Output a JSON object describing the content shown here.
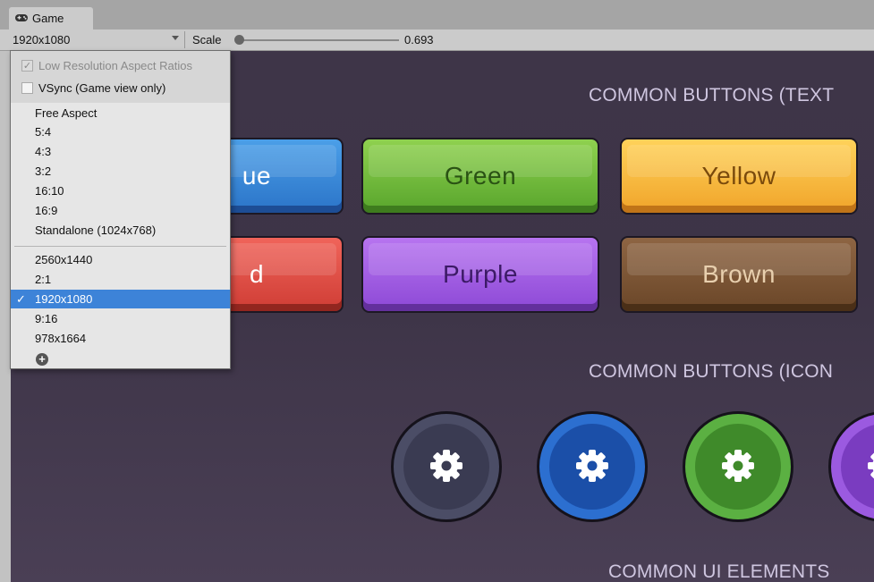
{
  "window": {
    "tab_label": "Game",
    "tab_icon": "gamepad-icon"
  },
  "toolbar": {
    "resolution": "1920x1080",
    "scale_label": "Scale",
    "scale_value": "0.693",
    "scale_level": 0.0
  },
  "dropdown": {
    "low_res_label": "Low Resolution Aspect Ratios",
    "low_res_checked": true,
    "vsync_label": "VSync (Game view only)",
    "vsync_checked": false,
    "items": [
      "Free Aspect",
      "5:4",
      "4:3",
      "3:2",
      "16:10",
      "16:9",
      "Standalone (1024x768)",
      "2560x1440",
      "2:1",
      "1920x1080",
      "9:16",
      "978x1664"
    ],
    "selected": "1920x1080",
    "add_icon": "plus-circle-icon"
  },
  "game": {
    "heading_text_buttons": "COMMON BUTTONS (TEXT",
    "heading_icon_buttons": "COMMON BUTTONS (ICON",
    "heading_ui_elements": "COMMON UI ELEMENTS",
    "buttons": {
      "blue_visible": "ue",
      "green": "Green",
      "yellow": "Yellow",
      "red_visible": "d",
      "purple": "Purple",
      "brown": "Brown"
    },
    "icon_buttons": [
      "gear-icon",
      "gear-icon",
      "gear-icon",
      "gear-icon"
    ],
    "colors": {
      "blue": "#2b74c8",
      "green": "#58a52c",
      "yellow": "#f0a42a",
      "red": "#cf3d35",
      "purple": "#8d49d6",
      "brown": "#6a4628",
      "background": "#3e3548"
    }
  }
}
